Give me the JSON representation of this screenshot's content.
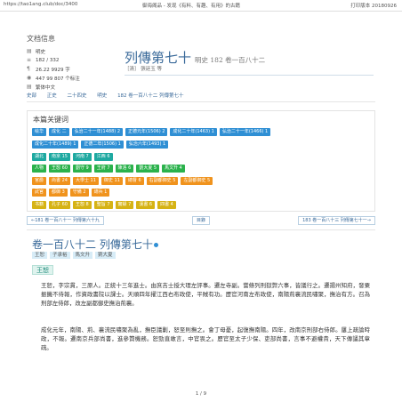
{
  "browser": {
    "url": "https://tao1ang.club/doc/3400",
    "page_title": "御海阁品 - 发现《有料、有趣、有用》的古籍",
    "version": "打印版本 20180926"
  },
  "info": {
    "heading": "文档信息",
    "rows": [
      {
        "icon": "book-icon",
        "text": "明史"
      },
      {
        "icon": "layers-icon",
        "text": "182 / 332"
      },
      {
        "icon": "text-icon",
        "text": "26.22 9929 字"
      },
      {
        "icon": "eye-icon",
        "text": "447 99 807 个标注"
      },
      {
        "icon": "book-icon",
        "text": "繁体中文"
      }
    ]
  },
  "title": {
    "main": "列傳第七十",
    "sub": "明史 182 卷一百八十二",
    "author": "［清］ 張廷玉 等"
  },
  "breadcrumb": [
    "史部",
    "正史",
    "二十四史",
    "明史",
    "182 卷一百八十二 列傳第七十"
  ],
  "keywords": {
    "heading": "本篇关键词",
    "rows": [
      [
        {
          "text": "绘华",
          "color": "blue"
        },
        {
          "text": "成化 二",
          "color": "blue"
        },
        {
          "text": "弘治二十一年(1488) 2",
          "color": "blue"
        },
        {
          "text": "正德元年(1506) 2",
          "color": "blue"
        },
        {
          "text": "成化二十年(1463) 1",
          "color": "blue"
        },
        {
          "text": "弘治二十一年(1466) 1",
          "color": "blue"
        }
      ],
      [
        {
          "text": "成化二十年(1489) 1",
          "color": "blue"
        },
        {
          "text": "正德二年(1506) 1",
          "color": "blue"
        },
        {
          "text": "弘治六年(1493) 1",
          "color": "blue"
        }
      ],
      [
        {
          "text": "湖北",
          "color": "teal"
        },
        {
          "text": "南京 15",
          "color": "teal"
        },
        {
          "text": "河南 7",
          "color": "teal"
        },
        {
          "text": "江西 6",
          "color": "teal"
        }
      ],
      [
        {
          "text": "人物",
          "color": "green"
        },
        {
          "text": "王恕 60",
          "color": "green"
        },
        {
          "text": "劉守 9",
          "color": "green"
        },
        {
          "text": "王府 7",
          "color": "green"
        },
        {
          "text": "陳洛 6",
          "color": "green"
        },
        {
          "text": "劉大夏 5",
          "color": "green"
        },
        {
          "text": "馬文升 4",
          "color": "green"
        }
      ],
      [
        {
          "text": "官爵",
          "color": "orange"
        },
        {
          "text": "尚書 24",
          "color": "orange"
        },
        {
          "text": "大學士 11",
          "color": "orange"
        },
        {
          "text": "御史 11",
          "color": "orange"
        },
        {
          "text": "總督 6",
          "color": "orange"
        },
        {
          "text": "右副都御史 5",
          "color": "orange"
        },
        {
          "text": "左副都御史 5",
          "color": "orange"
        }
      ],
      [
        {
          "text": "武官",
          "color": "orange"
        },
        {
          "text": "都御 3",
          "color": "orange"
        },
        {
          "text": "守備 2",
          "color": "orange"
        },
        {
          "text": "總兵 1",
          "color": "orange"
        }
      ],
      [
        {
          "text": "书籍",
          "color": "yellow"
        },
        {
          "text": "孔子 60",
          "color": "yellow"
        },
        {
          "text": "王恕 8",
          "color": "yellow"
        },
        {
          "text": "聖旨 7",
          "color": "yellow"
        },
        {
          "text": "實録 7",
          "color": "yellow"
        },
        {
          "text": "漢書 6",
          "color": "yellow"
        },
        {
          "text": "四書 4",
          "color": "yellow"
        }
      ]
    ]
  },
  "nav": {
    "prev": "←181 卷一百八十一 列傳第六十九",
    "index": "目錄",
    "next": "183 卷一百八十三 列傳第七十一→"
  },
  "juan": {
    "title": "卷一百八十二 列傳第七十",
    "highlights": [
      "王恕",
      "子承裕",
      "馬文升",
      "劉大夏"
    ],
    "tag": "王恕"
  },
  "paragraphs": [
    "王恕，字宗貫，三原人。正統十三年進士。由庶吉士授大理左評事。遷左寺副。嘗條列刑獄弊六事，皆議行之。遷揚州知府，發粟振饑不待報，作資政書院以課士。天順四年擢江西右布政使，平賊有功。歷官河南左布政使，南陽荊襄流民嘯聚，撫治有方。召為刑部左侍郎，改左副都御史撫治荊襄。",
    "成化元年，南陽、荊、襄流民嘯聚為亂，撫臣議剿，恕至則撫之。會丁母憂，起復撫南陽。四年，改南京刑部右侍郎。屢上疏論時政，不報。遷南京兵部尚書，進參贊機務。恕勁直敢言，中官畏之。歷官至太子少保、吏部尚書，言事不避權貴，天下傳誦其章疏。"
  ],
  "page": "1 / 9"
}
